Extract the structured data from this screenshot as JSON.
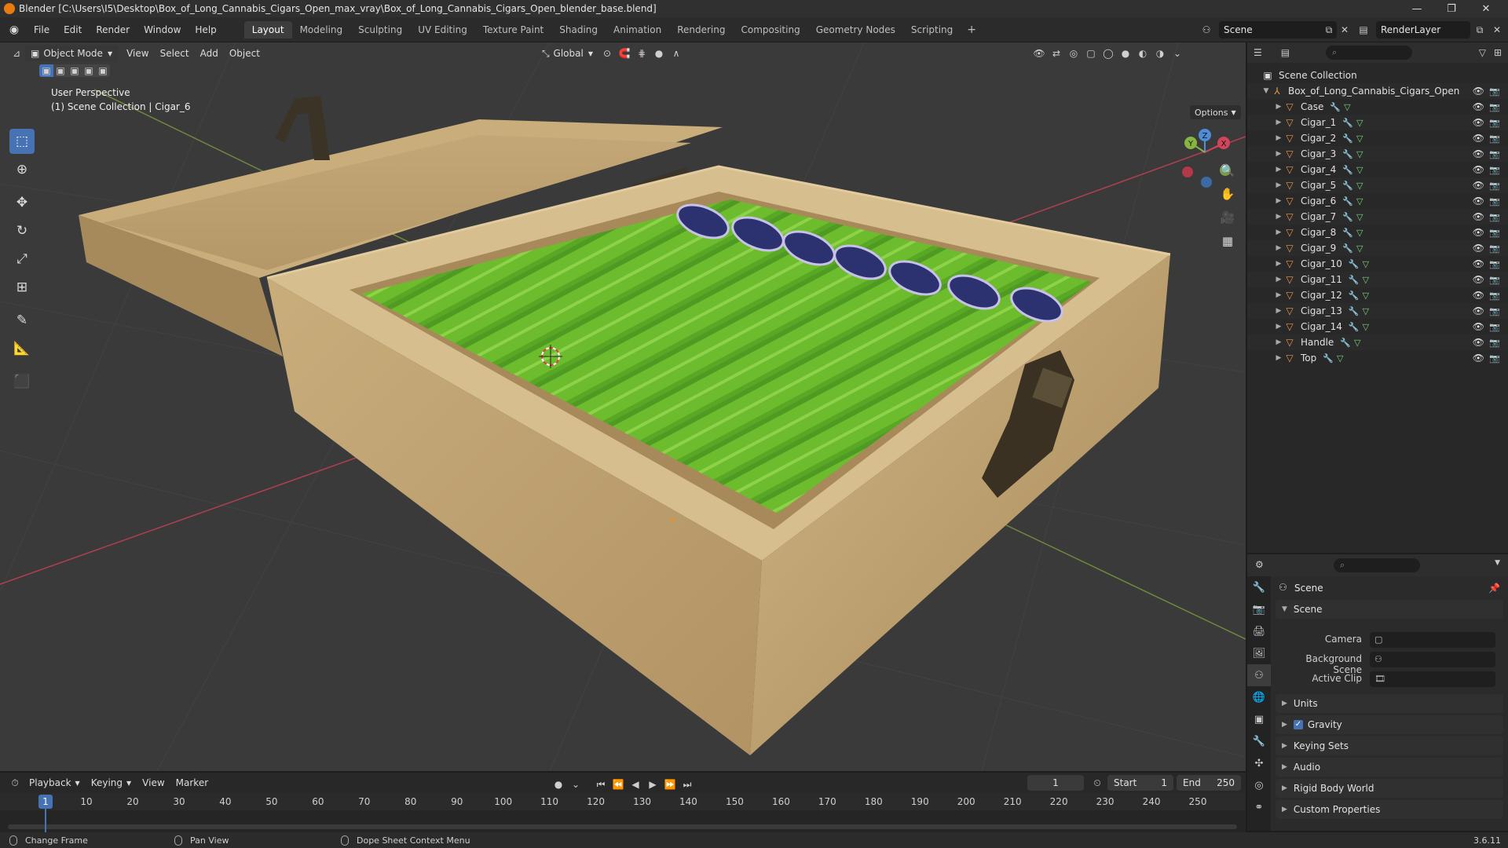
{
  "window": {
    "title": "Blender [C:\\Users\\I5\\Desktop\\Box_of_Long_Cannabis_Cigars_Open_max_vray\\Box_of_Long_Cannabis_Cigars_Open_blender_base.blend]",
    "minimize": "—",
    "maximize": "❐",
    "close": "✕"
  },
  "menu": [
    "File",
    "Edit",
    "Render",
    "Window",
    "Help"
  ],
  "workspaces": [
    "Layout",
    "Modeling",
    "Sculpting",
    "UV Editing",
    "Texture Paint",
    "Shading",
    "Animation",
    "Rendering",
    "Compositing",
    "Geometry Nodes",
    "Scripting"
  ],
  "workspace_add": "+",
  "active_workspace": "Layout",
  "scene_name": "Scene",
  "view_layer": "RenderLayer",
  "viewport": {
    "mode": "Object Mode",
    "menus": [
      "View",
      "Select",
      "Add",
      "Object"
    ],
    "transform": "Global",
    "perspective": "User Perspective",
    "collection_info": "(1) Scene Collection | Cigar_6",
    "options": "Options",
    "axis_x": "X",
    "axis_y": "Y",
    "axis_z": "Z"
  },
  "outliner": {
    "root": "Scene Collection",
    "collection": "Box_of_Long_Cannabis_Cigars_Open",
    "objects": [
      "Case",
      "Cigar_1",
      "Cigar_2",
      "Cigar_3",
      "Cigar_4",
      "Cigar_5",
      "Cigar_6",
      "Cigar_7",
      "Cigar_8",
      "Cigar_9",
      "Cigar_10",
      "Cigar_11",
      "Cigar_12",
      "Cigar_13",
      "Cigar_14",
      "Handle",
      "Top"
    ]
  },
  "properties": {
    "context": "Scene",
    "panel_scene": "Scene",
    "camera_label": "Camera",
    "background_label": "Background Scene",
    "clip_label": "Active Clip",
    "panels": [
      "Units",
      "Gravity",
      "Keying Sets",
      "Audio",
      "Rigid Body World",
      "Custom Properties"
    ]
  },
  "timeline": {
    "menus": [
      "Playback",
      "Keying",
      "View",
      "Marker"
    ],
    "current_frame": "1",
    "start_label": "Start",
    "start": "1",
    "end_label": "End",
    "end": "250",
    "ticks": [
      "1",
      "10",
      "20",
      "30",
      "40",
      "50",
      "60",
      "70",
      "80",
      "90",
      "100",
      "110",
      "120",
      "130",
      "140",
      "150",
      "160",
      "170",
      "180",
      "190",
      "200",
      "210",
      "220",
      "230",
      "240",
      "250"
    ]
  },
  "status": {
    "change_frame": "Change Frame",
    "pan_view": "Pan View",
    "context_menu": "Dope Sheet Context Menu",
    "version": "3.6.11"
  },
  "colors": {
    "accent": "#4772b3",
    "wood": "#c8ac7a",
    "cigar_green": "#6fbf2f",
    "band_blue": "#2a2f6e"
  }
}
